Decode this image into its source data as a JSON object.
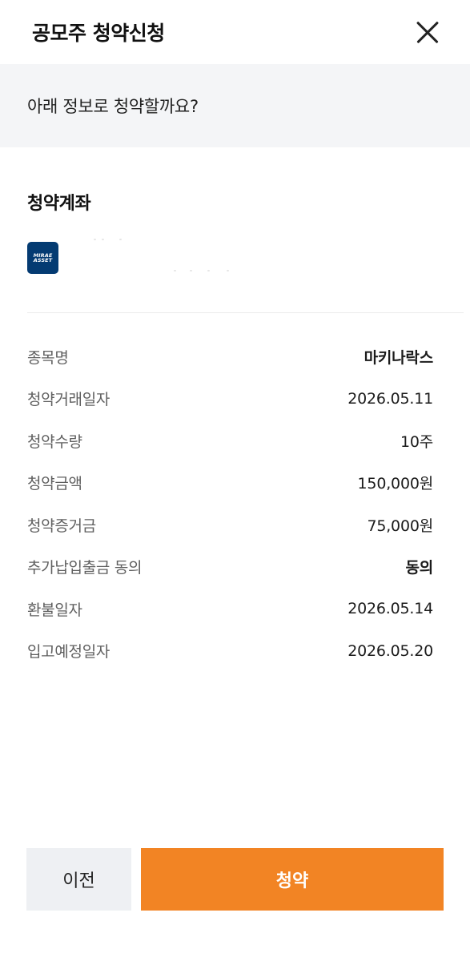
{
  "header": {
    "title": "공모주 청약신청"
  },
  "banner": {
    "text": "아래 정보로 청약할까요?"
  },
  "account": {
    "section_title": "청약계좌",
    "logo_line1": "MIRAE",
    "logo_line2": "ASSET",
    "brand_color": "#043b72"
  },
  "details": [
    {
      "label": "종목명",
      "value": "마키나락스"
    },
    {
      "label": "청약거래일자",
      "value": "2026.05.11"
    },
    {
      "label": "청약수량",
      "value": "10주"
    },
    {
      "label": "청약금액",
      "value": "150,000원"
    },
    {
      "label": "청약증거금",
      "value": "75,000원"
    },
    {
      "label": "추가납입출금 동의",
      "value": "동의"
    },
    {
      "label": "환불일자",
      "value": "2026.05.14"
    },
    {
      "label": "입고예정일자",
      "value": "2026.05.20"
    }
  ],
  "footer": {
    "prev_label": "이전",
    "submit_label": "청약",
    "accent_color": "#f28424"
  }
}
